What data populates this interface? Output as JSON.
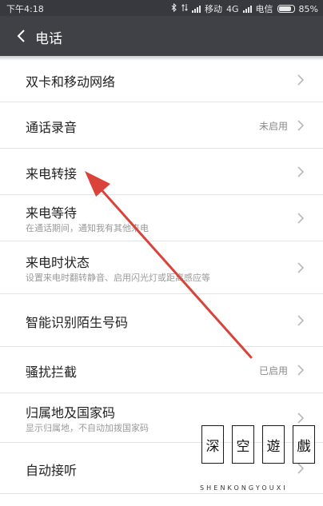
{
  "status_bar": {
    "time": "下午4:18",
    "carrier1": "移动",
    "network": "4G",
    "carrier2": "电信",
    "battery": "85%",
    "battery_level": 0.85
  },
  "header": {
    "title": "电话"
  },
  "items": [
    {
      "label": "双卡和移动网络",
      "sub": "",
      "status": ""
    },
    {
      "label": "通话录音",
      "sub": "",
      "status": "未启用"
    },
    {
      "label": "来电转接",
      "sub": "",
      "status": ""
    },
    {
      "label": "来电等待",
      "sub": "在通话期间，通知我有其他来电",
      "status": ""
    },
    {
      "label": "来电时状态",
      "sub": "设置来电时翻转静音、启用闪光灯或距离感应等",
      "status": ""
    },
    {
      "label": "智能识别陌生号码",
      "sub": "",
      "status": ""
    },
    {
      "label": "骚扰拦截",
      "sub": "",
      "status": "已启用"
    },
    {
      "label": "归属地及国家码",
      "sub": "显示归属地，不自动加拨国家码",
      "status": ""
    },
    {
      "label": "自动接听",
      "sub": "",
      "status": ""
    }
  ],
  "watermark": {
    "chars": [
      "深",
      "空",
      "遊",
      "戲"
    ],
    "text": "SHENKONGYOUXI"
  },
  "colors": {
    "status_bar": "#37393f",
    "title_bar": "#3f4147",
    "arrow": "#d9433a"
  },
  "icons": {
    "back": "chevron-left-icon",
    "row": "chevron-right-icon",
    "annotation": "red-arrow-annotation"
  }
}
